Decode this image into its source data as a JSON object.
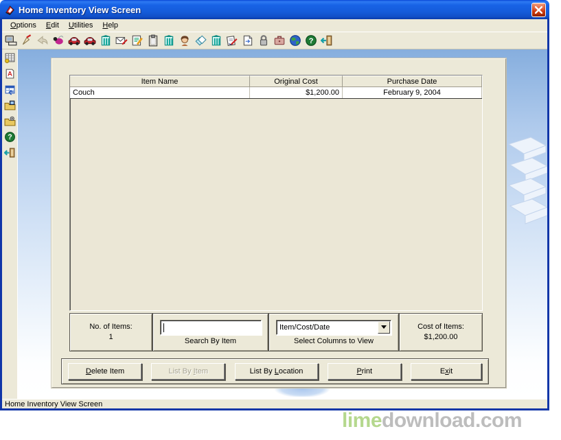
{
  "window": {
    "title": "Home Inventory View Screen"
  },
  "menu": {
    "items": [
      {
        "pre": "",
        "key": "O",
        "post": "ptions"
      },
      {
        "pre": "",
        "key": "E",
        "post": "dit"
      },
      {
        "pre": "",
        "key": "U",
        "post": "tilities"
      },
      {
        "pre": "",
        "key": "H",
        "post": "elp"
      }
    ]
  },
  "toolbar": {
    "icons": [
      "print",
      "write-hand",
      "undo-arrow",
      "bug",
      "car-red",
      "car-red-2",
      "building-teal",
      "envelope-pen",
      "note-edit",
      "clipboard",
      "building-teal-2",
      "person",
      "hand-cards",
      "building-teal-3",
      "sign-document",
      "page-turn",
      "padlock",
      "briefcase",
      "globe",
      "help",
      "exit-door"
    ]
  },
  "sidebar": {
    "icons": [
      "spreadsheet-grid",
      "font-a",
      "table-view",
      "folder-display",
      "folder-tools",
      "help",
      "exit-door"
    ]
  },
  "table": {
    "columns": [
      "Item Name",
      "Original Cost",
      "Purchase Date"
    ],
    "rows": [
      {
        "item": "Couch",
        "cost": "$1,200.00",
        "date": "February 9, 2004"
      }
    ]
  },
  "info_panel": {
    "items_count_label": "No. of Items:",
    "items_count_value": "1",
    "search_value": "",
    "search_label": "Search By Item",
    "columns_select_value": "Item/Cost/Date",
    "columns_select_label": "Select Columns to View",
    "cost_label": "Cost of Items:",
    "cost_value": "$1,200.00"
  },
  "buttons": {
    "delete": {
      "pre": "",
      "key": "D",
      "post": "elete Item"
    },
    "list_by_item": {
      "pre": "List By ",
      "key": "I",
      "post": "tem"
    },
    "list_by_location": {
      "pre": "List By ",
      "key": "L",
      "post": "ocation"
    },
    "print": {
      "pre": "",
      "key": "P",
      "post": "rint"
    },
    "exit": {
      "pre": "E",
      "key": "x",
      "post": "it"
    }
  },
  "status_bar": {
    "text": "Home Inventory View Screen"
  },
  "watermark": {
    "prefix": "lime",
    "suffix": "download.com"
  },
  "colors": {
    "titlebar_blue": "#1459D6",
    "window_border": "#1136A8",
    "close_red": "#CC3B12",
    "panel_beige": "#ECE9D8",
    "help_green": "#1E7B34",
    "watermark_green": "#B5D88E",
    "watermark_gray": "#BDBDBD"
  }
}
